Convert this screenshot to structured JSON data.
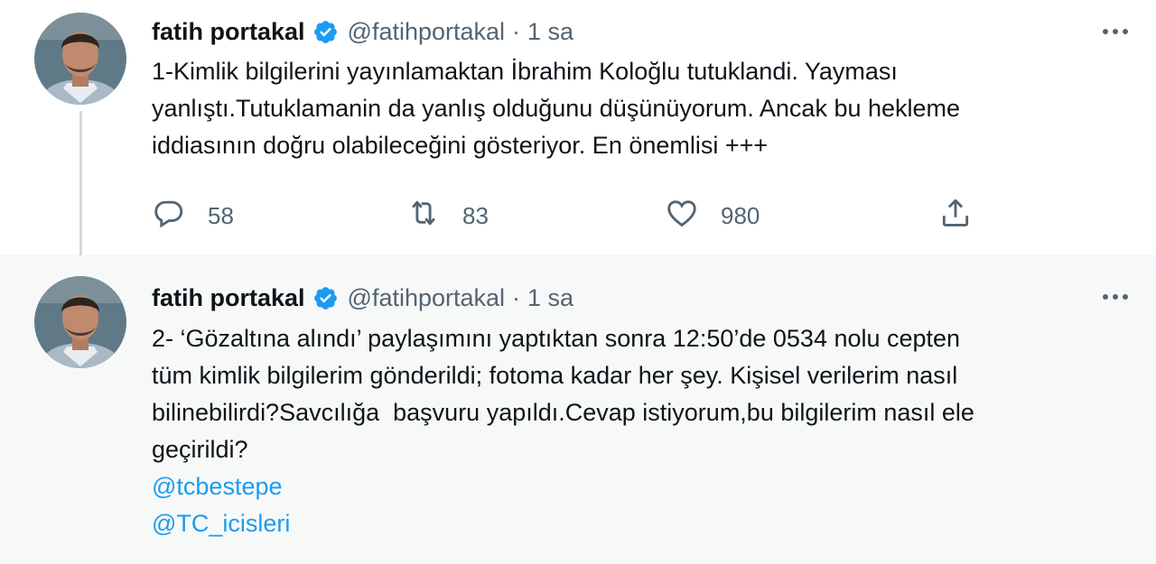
{
  "tweets": [
    {
      "author_name": "fatih portakal",
      "handle": "@fatihportakal",
      "separator": "·",
      "time": "1 sa",
      "text": "1-Kimlik bilgilerini yayınlamaktan İbrahim Koloğlu tutuklandi. Yayması\nyanlıştı.Tutuklamanin da yanlış olduğunu düşünüyorum. Ancak bu hekleme\niddiasının doğru olabileceğini gösteriyor. En önemlisi +++",
      "replies": "58",
      "retweets": "83",
      "likes": "980"
    },
    {
      "author_name": "fatih portakal",
      "handle": "@fatihportakal",
      "separator": "·",
      "time": "1 sa",
      "text": "2- ‘Gözaltına alındı’ paylaşımını yaptıktan sonra 12:50’de 0534 nolu cepten\ntüm kimlik bilgilerim gönderildi; fotoma kadar her şey. Kişisel verilerim nasıl\nbilinebilirdi?Savcılığa  başvuru yapıldı.Cevap istiyorum,bu bilgilerim nasıl ele\ngeçirildi?",
      "mentions": [
        "@tcbestepe",
        "@TC_icisleri"
      ]
    }
  ],
  "icons": {
    "verified": "verified-badge-icon",
    "more": "more-options-icon",
    "reply": "reply-icon",
    "retweet": "retweet-icon",
    "like": "like-icon",
    "share": "share-icon"
  },
  "colors": {
    "accent": "#1d9bf0",
    "text": "#0f1419",
    "secondary": "#536471",
    "hover_background": "#f7f9f9"
  }
}
